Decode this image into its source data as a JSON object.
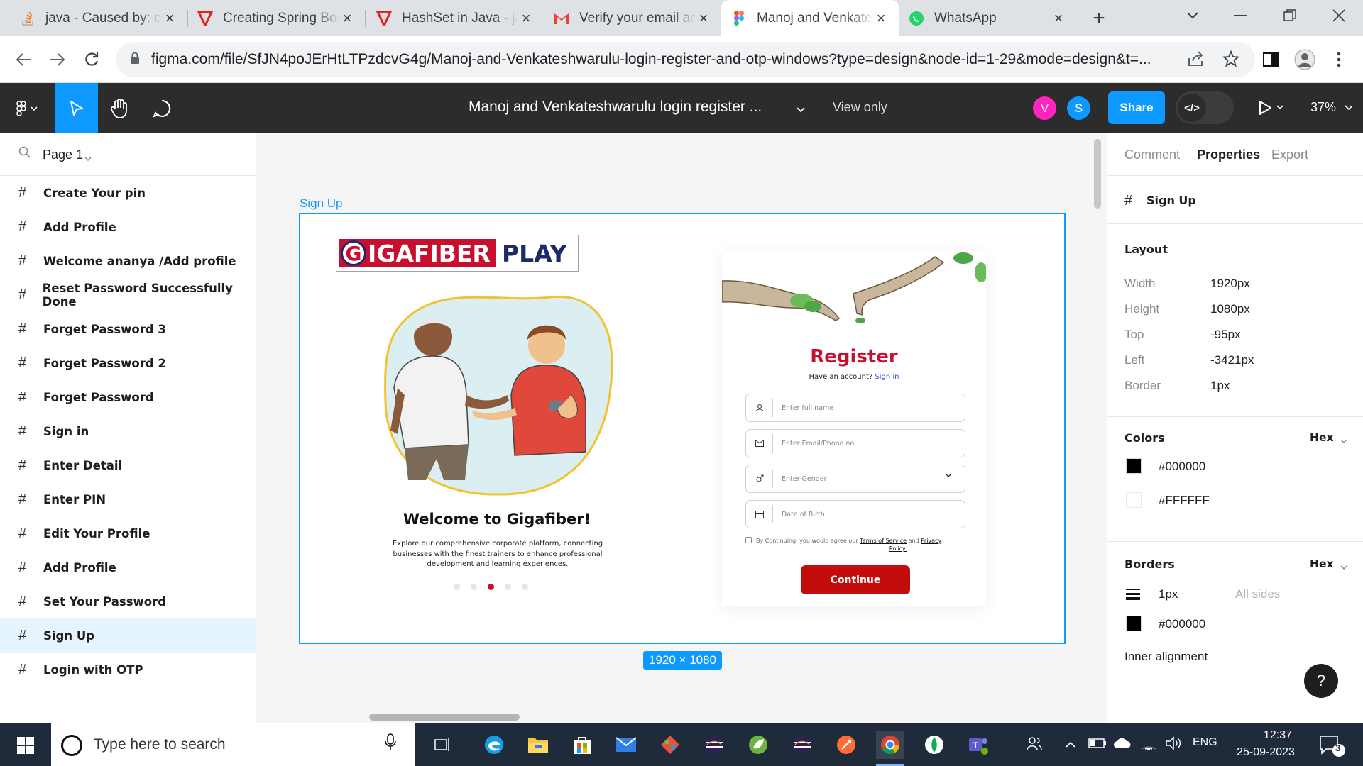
{
  "browser": {
    "tabs": [
      {
        "title": "java - Caused by: org.springframework",
        "icon": "stackoverflow-icon",
        "color": "#f48024",
        "active": false
      },
      {
        "title": "Creating Spring Boot Application",
        "icon": "tutorial-icon",
        "color": "#e1251b",
        "active": false
      },
      {
        "title": "HashSet in Java - javatpoint",
        "icon": "tutorial-icon",
        "color": "#e1251b",
        "active": false
      },
      {
        "title": "Verify your email address",
        "icon": "gmail-icon",
        "color": "#ea4335",
        "active": false
      },
      {
        "title": "Manoj and Venkateshwarulu",
        "icon": "figma-icon",
        "color": "#a259ff",
        "active": true
      },
      {
        "title": "WhatsApp",
        "icon": "whatsapp-icon",
        "color": "#25d366",
        "active": false
      }
    ],
    "new_tab_label": "+",
    "url": "figma.com/file/SfJN4poJErHtLTPzdcvG4g/Manoj-and-Venkateshwarulu-login-register-and-otp-windows?type=design&node-id=1-29&mode=design&t=..."
  },
  "figma": {
    "file_title": "Manoj and Venkateshwarulu login register ...",
    "view_only": "View only",
    "avatars": [
      {
        "initial": "V",
        "color": "#ff24bd"
      },
      {
        "initial": "S",
        "color": "#0d99ff"
      }
    ],
    "share_label": "Share",
    "dev_mode_icon": "</>",
    "zoom": "37%",
    "accent": "#0d99ff"
  },
  "left_panel": {
    "page_name": "Page 1",
    "layers": [
      "Create Your pin",
      "Add Profile",
      "Welcome ananya /Add profile",
      "Reset Password Successfully Done",
      "Forget Password 3",
      "Forget Password 2",
      "Forget Password",
      "Sign in",
      "Enter Detail",
      "Enter PIN",
      "Edit Your Profile",
      "Add Profile",
      "Set Your Password",
      "Sign Up",
      "Login with OTP"
    ],
    "selected_layer": "Sign Up"
  },
  "canvas": {
    "frame_label": "Sign Up",
    "frame_size": "1920 × 1080",
    "design": {
      "logo_main": "IGAFIBER",
      "logo_g": "G",
      "logo_play": "PLAY",
      "welcome_title": "Welcome to Gigafiber!",
      "welcome_desc": "Explore our comprehensive corporate  platform, connecting businesses with the finest trainers to enhance professional development and learning experiences.",
      "carousel_total": 5,
      "carousel_active": 3,
      "register_title": "Register",
      "have_account": "Have an account?",
      "sign_in_link": "Sign in",
      "fields": [
        {
          "icon": "user-icon",
          "placeholder": "Enter full name"
        },
        {
          "icon": "mail-icon",
          "placeholder": "Enter Email/Phone no."
        },
        {
          "icon": "gender-icon",
          "placeholder": "Enter Gender"
        },
        {
          "icon": "calendar-icon",
          "placeholder": "Date of Birth"
        }
      ],
      "consent_prefix": "By Continuing, you would agree our",
      "terms": "Terms of Service",
      "and": "and",
      "privacy_1": "Privacy",
      "privacy_2": "Policy.",
      "continue_label": "Continue",
      "brand_red": "#c8102e"
    }
  },
  "right_panel": {
    "tabs": [
      "Comment",
      "Properties",
      "Export"
    ],
    "active_tab": "Properties",
    "frame_name": "Sign Up",
    "layout_heading": "Layout",
    "layout": [
      {
        "label": "Width",
        "value": "1920px"
      },
      {
        "label": "Height",
        "value": "1080px"
      },
      {
        "label": "Top",
        "value": "-95px"
      },
      {
        "label": "Left",
        "value": "-3421px"
      },
      {
        "label": "Border",
        "value": "1px"
      }
    ],
    "colors_heading": "Colors",
    "colors_format": "Hex",
    "colors": [
      "#000000",
      "#FFFFFF"
    ],
    "borders_heading": "Borders",
    "borders_format": "Hex",
    "border_width": "1px",
    "border_sides": "All sides",
    "border_color": "#000000",
    "inner_alignment": "Inner alignment",
    "help_label": "?"
  },
  "taskbar": {
    "search_placeholder": "Type here to search",
    "language": "ENG",
    "time": "12:37",
    "date": "25-09-2023",
    "notification_count": "3",
    "apps": [
      "task-view-icon",
      "edge-icon",
      "file-explorer-icon",
      "store-icon",
      "mail-icon",
      "git-icon",
      "eclipse-icon",
      "spring-tools-icon",
      "eclipse-icon",
      "postman-icon",
      "chrome-icon",
      "mongodb-compass-icon",
      "teams-icon"
    ]
  }
}
